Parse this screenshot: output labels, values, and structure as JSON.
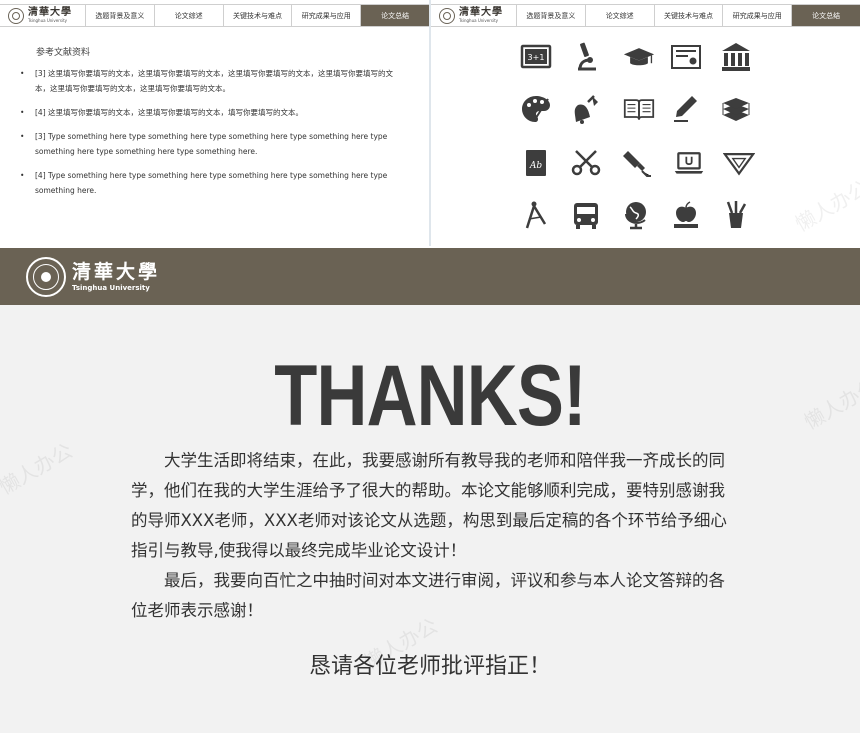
{
  "nav": {
    "logo_cn": "清華大學",
    "logo_en": "Tsinghua University",
    "tabs": [
      "选题背景及意义",
      "论文综述",
      "关键技术与难点",
      "研究成果与应用",
      "论文总结"
    ],
    "active_tab": "论文总结"
  },
  "references": {
    "title": "参考文献资料",
    "items": [
      "[3] 这里填写你要填写的文本，这里填写你要填写的文本，这里填写你要填写的文本，这里填写你要填写的文本，这里填写你要填写的文本，这里填写你要填写的文本。",
      "[4] 这里填写你要填写的文本，这里填写你要填写的文本，填写你要填写的文本。",
      "[3] Type something here type something here type something here type something here type something here type something here type something here.",
      "[4] Type something here type something here type something here type something here type something here."
    ]
  },
  "icons": [
    "blackboard-icon",
    "microscope-icon",
    "graduation-cap-icon",
    "certificate-icon",
    "museum-icon",
    "palette-icon",
    "bell-icon",
    "open-book-icon",
    "pencil-icon",
    "book-stack-icon",
    "notebook-icon",
    "scissors-icon",
    "highlighter-icon",
    "laptop-icon",
    "set-square-icon",
    "compass-icon",
    "school-bus-icon",
    "globe-icon",
    "apple-books-icon",
    "pencil-cup-icon"
  ],
  "blackboard_text": "3+1",
  "notebook_text": "Ab",
  "banner": {
    "logo_cn": "清華大學",
    "logo_en": "Tsinghua University"
  },
  "thanks": {
    "heading": "THANKS!",
    "paragraph1": "大学生活即将结束，在此，我要感谢所有教导我的老师和陪伴我一齐成长的同学，他们在我的大学生涯给予了很大的帮助。本论文能够顺利完成，要特别感谢我的导师XXX老师，XXX老师对该论文从选题，构思到最后定稿的各个环节给予细心指引与教导,使我得以最终完成毕业论文设计！",
    "paragraph2": "最后，我要向百忙之中抽时间对本文进行审阅，评议和参与本人论文答辩的各位老师表示感谢！",
    "closing": "恳请各位老师批评指正！"
  },
  "colors": {
    "brand": "#6a6254",
    "icon": "#3d3d3d"
  }
}
